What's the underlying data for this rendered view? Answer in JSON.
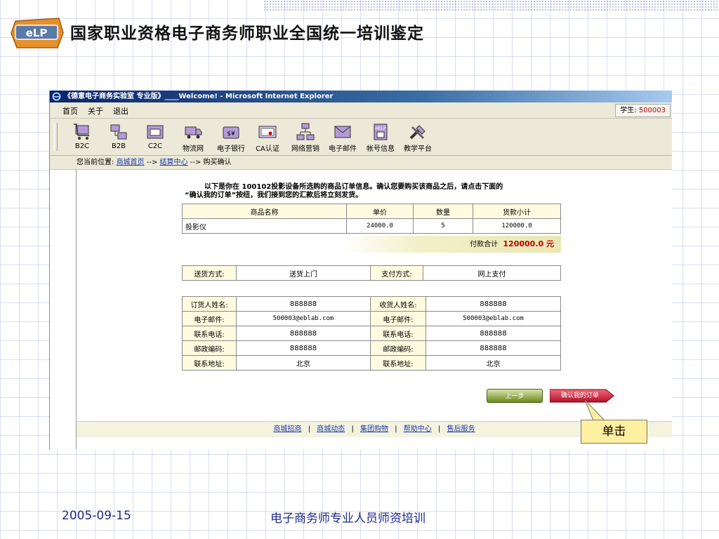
{
  "slide": {
    "logo_text": "eLP",
    "title": "国家职业资格电子商务师职业全国统一培训鉴定",
    "date": "2005-09-15",
    "bottom_title": "电子商务师专业人员师资培训",
    "callout": "单击"
  },
  "browser": {
    "window_title": "《德意电子商务实验室 专业版》____Welcome! - Microsoft Internet Explorer",
    "menu": [
      "首页",
      "关于",
      "退出"
    ],
    "student_label": "学生:",
    "student_id": "500003",
    "toolbar": [
      {
        "label": "B2C",
        "icon": "cart-icon"
      },
      {
        "label": "B2B",
        "icon": "b2b-icon"
      },
      {
        "label": "C2C",
        "icon": "c2c-icon"
      },
      {
        "label": "物流网",
        "icon": "truck-icon"
      },
      {
        "label": "电子银行",
        "icon": "bank-icon"
      },
      {
        "label": "CA认证",
        "icon": "certificate-icon"
      },
      {
        "label": "网络营销",
        "icon": "network-icon"
      },
      {
        "label": "电子邮件",
        "icon": "mail-icon"
      },
      {
        "label": "帐号信息",
        "icon": "help-account-icon"
      },
      {
        "label": "教学平台",
        "icon": "tools-icon"
      }
    ],
    "breadcrumb": {
      "prefix": "您当前位置:",
      "home": "商城首页",
      "sep1": "-->",
      "checkout": "结算中心",
      "sep2": "-->",
      "current": "购买确认"
    }
  },
  "order": {
    "intro_line1": "以下是你在 100102投影设备所选购的商品订单信息。确认您要购买该商品之后，请点击下面的",
    "intro_line2": "“确认我的订单”按纽，我们接到您的汇款后将立刻发货。",
    "headers": [
      "商品名称",
      "单价",
      "数量",
      "货款小计"
    ],
    "row": [
      "投影仪",
      "24000.0",
      "5",
      "120000.0"
    ],
    "total_label": "付款合计",
    "total_value": "120000.0 元",
    "delivery_label": "送货方式:",
    "delivery_value": "送货上门",
    "payment_label": "支付方式:",
    "payment_value": "网上支付",
    "contacts": [
      {
        "l1": "订货人姓名:",
        "v1": "888888",
        "l2": "收货人姓名:",
        "v2": "888888"
      },
      {
        "l1": "电子邮件:",
        "v1": "500003@eblab.com",
        "l2": "电子邮件:",
        "v2": "500003@eblab.com"
      },
      {
        "l1": "联系电话:",
        "v1": "888888",
        "l2": "联系电话:",
        "v2": "888888"
      },
      {
        "l1": "邮政编码:",
        "v1": "888888",
        "l2": "邮政编码:",
        "v2": "888888"
      },
      {
        "l1": "联系地址:",
        "v1": "北京",
        "l2": "联系地址:",
        "v2": "北京"
      }
    ],
    "prev_button": "上一步",
    "confirm_button": "确认我的订单"
  },
  "footer": {
    "links": [
      "商城招商",
      "商城动态",
      "集团购物",
      "帮助中心",
      "售后服务"
    ],
    "separator": "|"
  },
  "colors": {
    "accent_red": "#c00000",
    "title_blue": "#1f2a8a",
    "panel_beige": "#ece9d8"
  }
}
